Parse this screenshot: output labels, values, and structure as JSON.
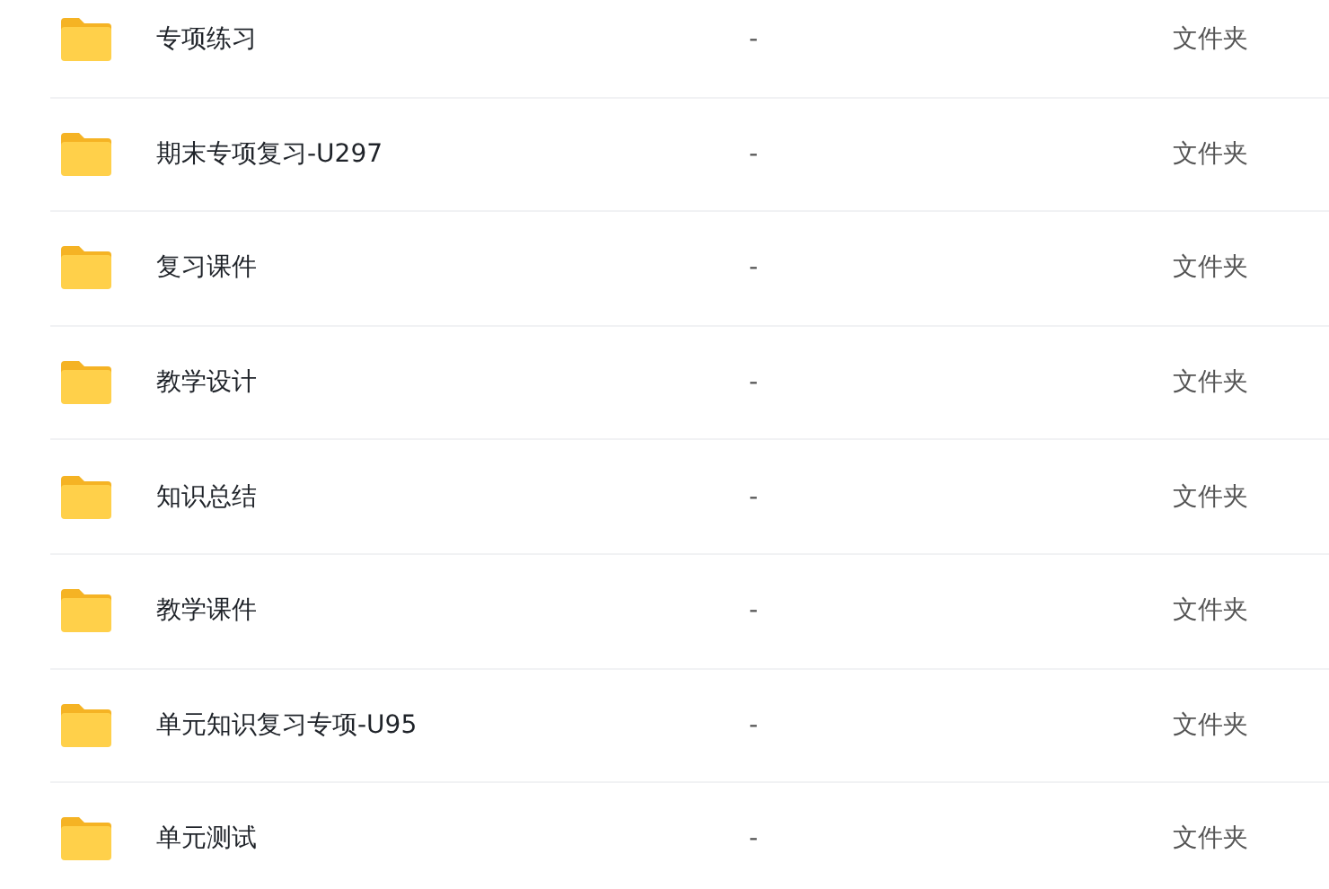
{
  "files": [
    {
      "name": "专项练习",
      "size": "-",
      "type": "文件夹"
    },
    {
      "name": "期末专项复习-U297",
      "size": "-",
      "type": "文件夹"
    },
    {
      "name": "复习课件",
      "size": "-",
      "type": "文件夹"
    },
    {
      "name": "教学设计",
      "size": "-",
      "type": "文件夹"
    },
    {
      "name": "知识总结",
      "size": "-",
      "type": "文件夹"
    },
    {
      "name": "教学课件",
      "size": "-",
      "type": "文件夹"
    },
    {
      "name": "单元知识复习专项-U95",
      "size": "-",
      "type": "文件夹"
    },
    {
      "name": "单元测试",
      "size": "-",
      "type": "文件夹"
    }
  ]
}
